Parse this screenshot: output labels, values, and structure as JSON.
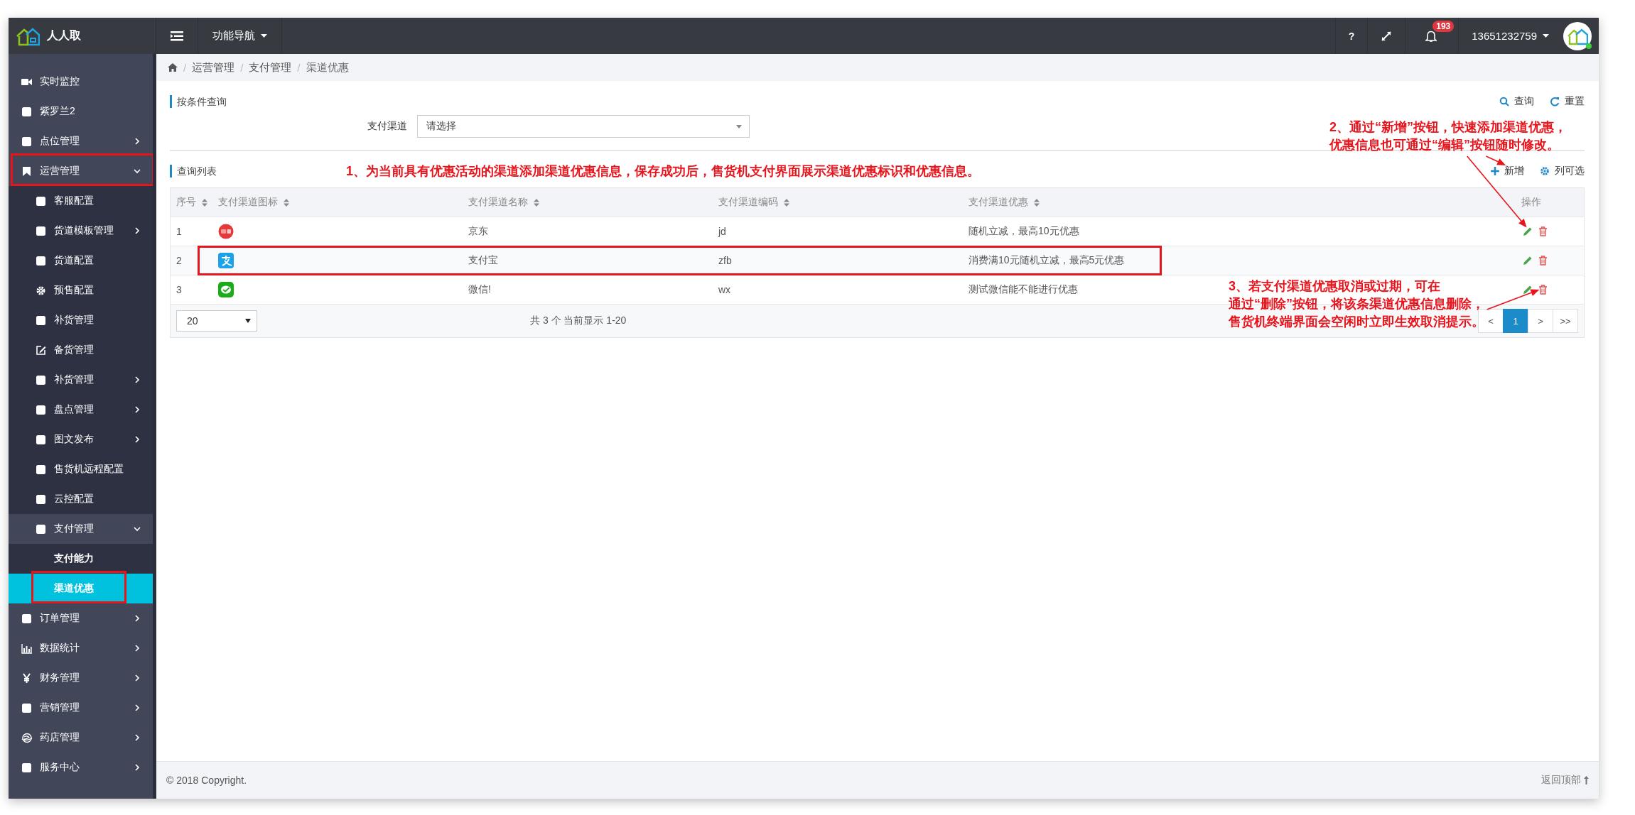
{
  "brand": {
    "name": "人人取"
  },
  "topbar": {
    "nav_menu": "功能导航",
    "help": "?",
    "notification_count": "193",
    "user": "13651232759"
  },
  "sidebar": {
    "items": [
      {
        "label": "实时监控",
        "kind": "video",
        "selected": false
      },
      {
        "label": "紫罗兰2",
        "kind": "square",
        "selected": false
      },
      {
        "label": "点位管理",
        "kind": "square",
        "selected": false,
        "expanded": false
      },
      {
        "label": "运营管理",
        "kind": "bookmark",
        "selected": false,
        "expanded": true,
        "annotated": true,
        "children": [
          {
            "label": "客服配置",
            "kind": "square",
            "selected": false
          },
          {
            "label": "货道模板管理",
            "kind": "square",
            "selected": false,
            "expanded": false
          },
          {
            "label": "货道配置",
            "kind": "square",
            "selected": false
          },
          {
            "label": "预售配置",
            "kind": "gear",
            "selected": false
          },
          {
            "label": "补货管理",
            "kind": "square",
            "selected": false
          },
          {
            "label": "备货管理",
            "kind": "edit",
            "selected": false
          },
          {
            "label": "补货管理",
            "kind": "square",
            "selected": false,
            "expanded": false
          },
          {
            "label": "盘点管理",
            "kind": "square",
            "selected": false,
            "expanded": false
          },
          {
            "label": "图文发布",
            "kind": "square",
            "selected": false,
            "expanded": false
          },
          {
            "label": "售货机远程配置",
            "kind": "square",
            "selected": false
          },
          {
            "label": "云控配置",
            "kind": "square",
            "selected": false
          },
          {
            "label": "支付管理",
            "kind": "square",
            "selected": false,
            "expanded": true,
            "children": [
              {
                "label": "支付能力",
                "selected": false
              },
              {
                "label": "渠道优惠",
                "selected": true,
                "annotated": true
              }
            ]
          }
        ]
      },
      {
        "label": "订单管理",
        "kind": "square",
        "selected": false,
        "expanded": false
      },
      {
        "label": "数据统计",
        "kind": "chart",
        "selected": false,
        "expanded": false
      },
      {
        "label": "财务管理",
        "kind": "yen",
        "selected": false,
        "expanded": false
      },
      {
        "label": "营销管理",
        "kind": "square",
        "selected": false,
        "expanded": false
      },
      {
        "label": "药店管理",
        "kind": "globe",
        "selected": false,
        "expanded": false
      },
      {
        "label": "服务中心",
        "kind": "square",
        "selected": false,
        "expanded": false
      }
    ]
  },
  "breadcrumb": {
    "separator": "/",
    "items": [
      "运营管理",
      "支付管理",
      "渠道优惠"
    ]
  },
  "search_panel": {
    "title": "按条件查询",
    "query_button": "查询",
    "reset_button": "重置",
    "filters": [
      {
        "label": "支付渠道",
        "placeholder": "请选择"
      }
    ]
  },
  "list_panel": {
    "title": "查询列表",
    "add_button": "新增",
    "columns_button": "列可选"
  },
  "table": {
    "columns": [
      {
        "label": "序号",
        "sortable": true
      },
      {
        "label": "支付渠道图标",
        "sortable": true
      },
      {
        "label": "支付渠道名称",
        "sortable": true
      },
      {
        "label": "支付渠道编码",
        "sortable": true
      },
      {
        "label": "支付渠道优惠",
        "sortable": true
      },
      {
        "label": "操作",
        "sortable": false
      }
    ],
    "rows": [
      {
        "index": "1",
        "kind": "jd",
        "name": "京东",
        "code": "jd",
        "discount": "随机立减，最高10元优惠"
      },
      {
        "index": "2",
        "kind": "alipay",
        "name": "支付宝",
        "code": "zfb",
        "discount": "消费满10元随机立减，最高5元优惠",
        "annotated": true
      },
      {
        "index": "3",
        "kind": "wechat",
        "name": "微信!",
        "code": "wx",
        "discount": "测试微信能不能进行优惠"
      }
    ]
  },
  "pagination": {
    "page_size": "20",
    "summary": "共 3 个 当前显示 1-20",
    "pages": [
      {
        "label": "<",
        "selected": false
      },
      {
        "label": "1",
        "selected": true
      },
      {
        "label": ">",
        "selected": false
      },
      {
        "label": ">>",
        "selected": false
      }
    ]
  },
  "footer": {
    "copyright": "© 2018 Copyright.",
    "back_to_top": "返回顶部"
  },
  "annotations": [
    {
      "lines": [
        "1、为当前具有优惠活动的渠道添加渠道优惠信息，保存成功后，售货机支付界面展示渠道优惠标识和优惠信息。"
      ]
    },
    {
      "lines": [
        "2、通过“新增”按钮，快速添加渠道优惠，",
        "优惠信息也可通过“编辑”按钮随时修改。"
      ]
    },
    {
      "lines": [
        "3、若支付渠道优惠取消或过期，可在",
        "通过“删除”按钮，将该条渠道优惠信息删除，",
        "售货机终端界面会空闲时立即生效取消提示。"
      ]
    }
  ]
}
